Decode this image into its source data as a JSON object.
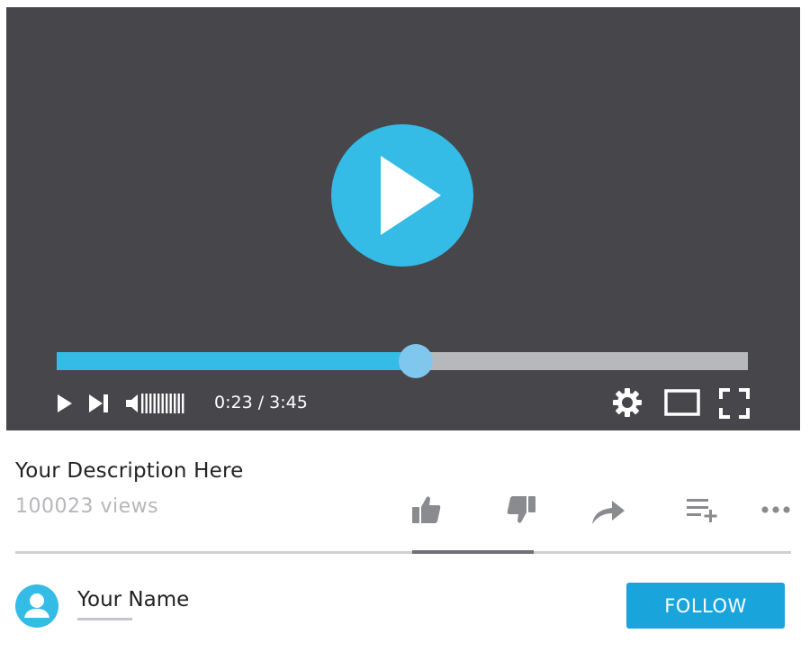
{
  "player": {
    "progress": 0.52,
    "time_current": "0:23",
    "time_total": "3:45",
    "time_display": "0:23 / 3:45",
    "controls": {
      "play_icon": "play-icon",
      "next_icon": "skip-next-icon",
      "volume_icon": "volume-icon",
      "settings_icon": "gear-icon",
      "theater_icon": "theater-mode-icon",
      "fullscreen_icon": "fullscreen-icon"
    }
  },
  "video": {
    "description": "Your Description Here",
    "views": "100023 views"
  },
  "actions": [
    "thumbs-up-icon",
    "thumbs-down-icon",
    "share-icon",
    "add-to-playlist-icon",
    "more-icon"
  ],
  "channel": {
    "name": "Your Name",
    "follow_label": "FOLLOW"
  },
  "colors": {
    "accent": "#34bbe6",
    "player_bg": "#47464b",
    "follow_button": "#1aa4dc",
    "track": "#b7b8bb"
  }
}
